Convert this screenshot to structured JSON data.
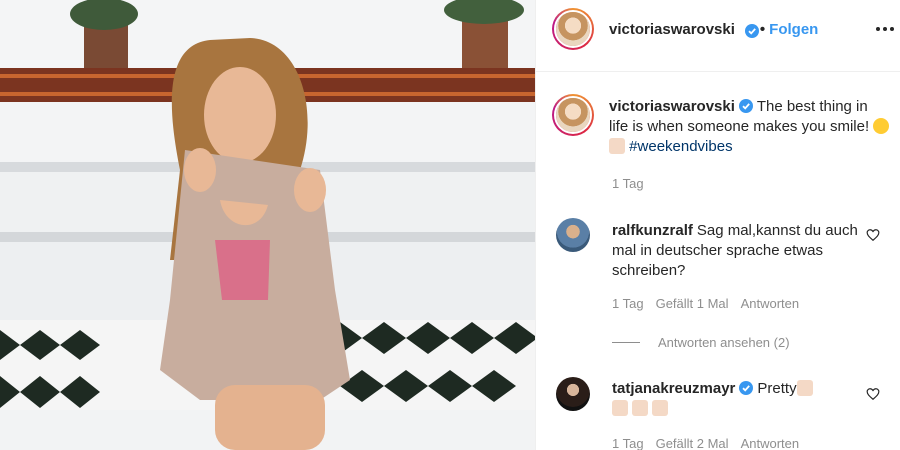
{
  "post": {
    "author": "victoriaswarovski",
    "follow_separator": "•",
    "follow_label": "Folgen",
    "caption_text": "The best thing in life is when someone makes you smile!",
    "caption_hashtag": "#weekendvibes",
    "caption_time": "1 Tag"
  },
  "comments": [
    {
      "username": "ralfkunzralf",
      "text": "Sag mal,kannst du auch mal in deutscher sprache etwas schreiben?",
      "time": "1 Tag",
      "likes": "Gefällt 1 Mal",
      "reply_label": "Antworten",
      "view_replies": "Antworten ansehen (2)"
    },
    {
      "username": "tatjanakreuzmayr",
      "text": "Pretty",
      "time": "1 Tag",
      "likes": "Gefällt 2 Mal",
      "reply_label": "Antworten"
    }
  ],
  "icons": {
    "verified": "verified-badge-icon",
    "more": "more-options-icon",
    "like": "heart-icon"
  },
  "colors": {
    "link_blue": "#3897f0",
    "hashtag": "#003569",
    "muted": "#8e8e8e",
    "verified_blue": "#3897f0"
  }
}
